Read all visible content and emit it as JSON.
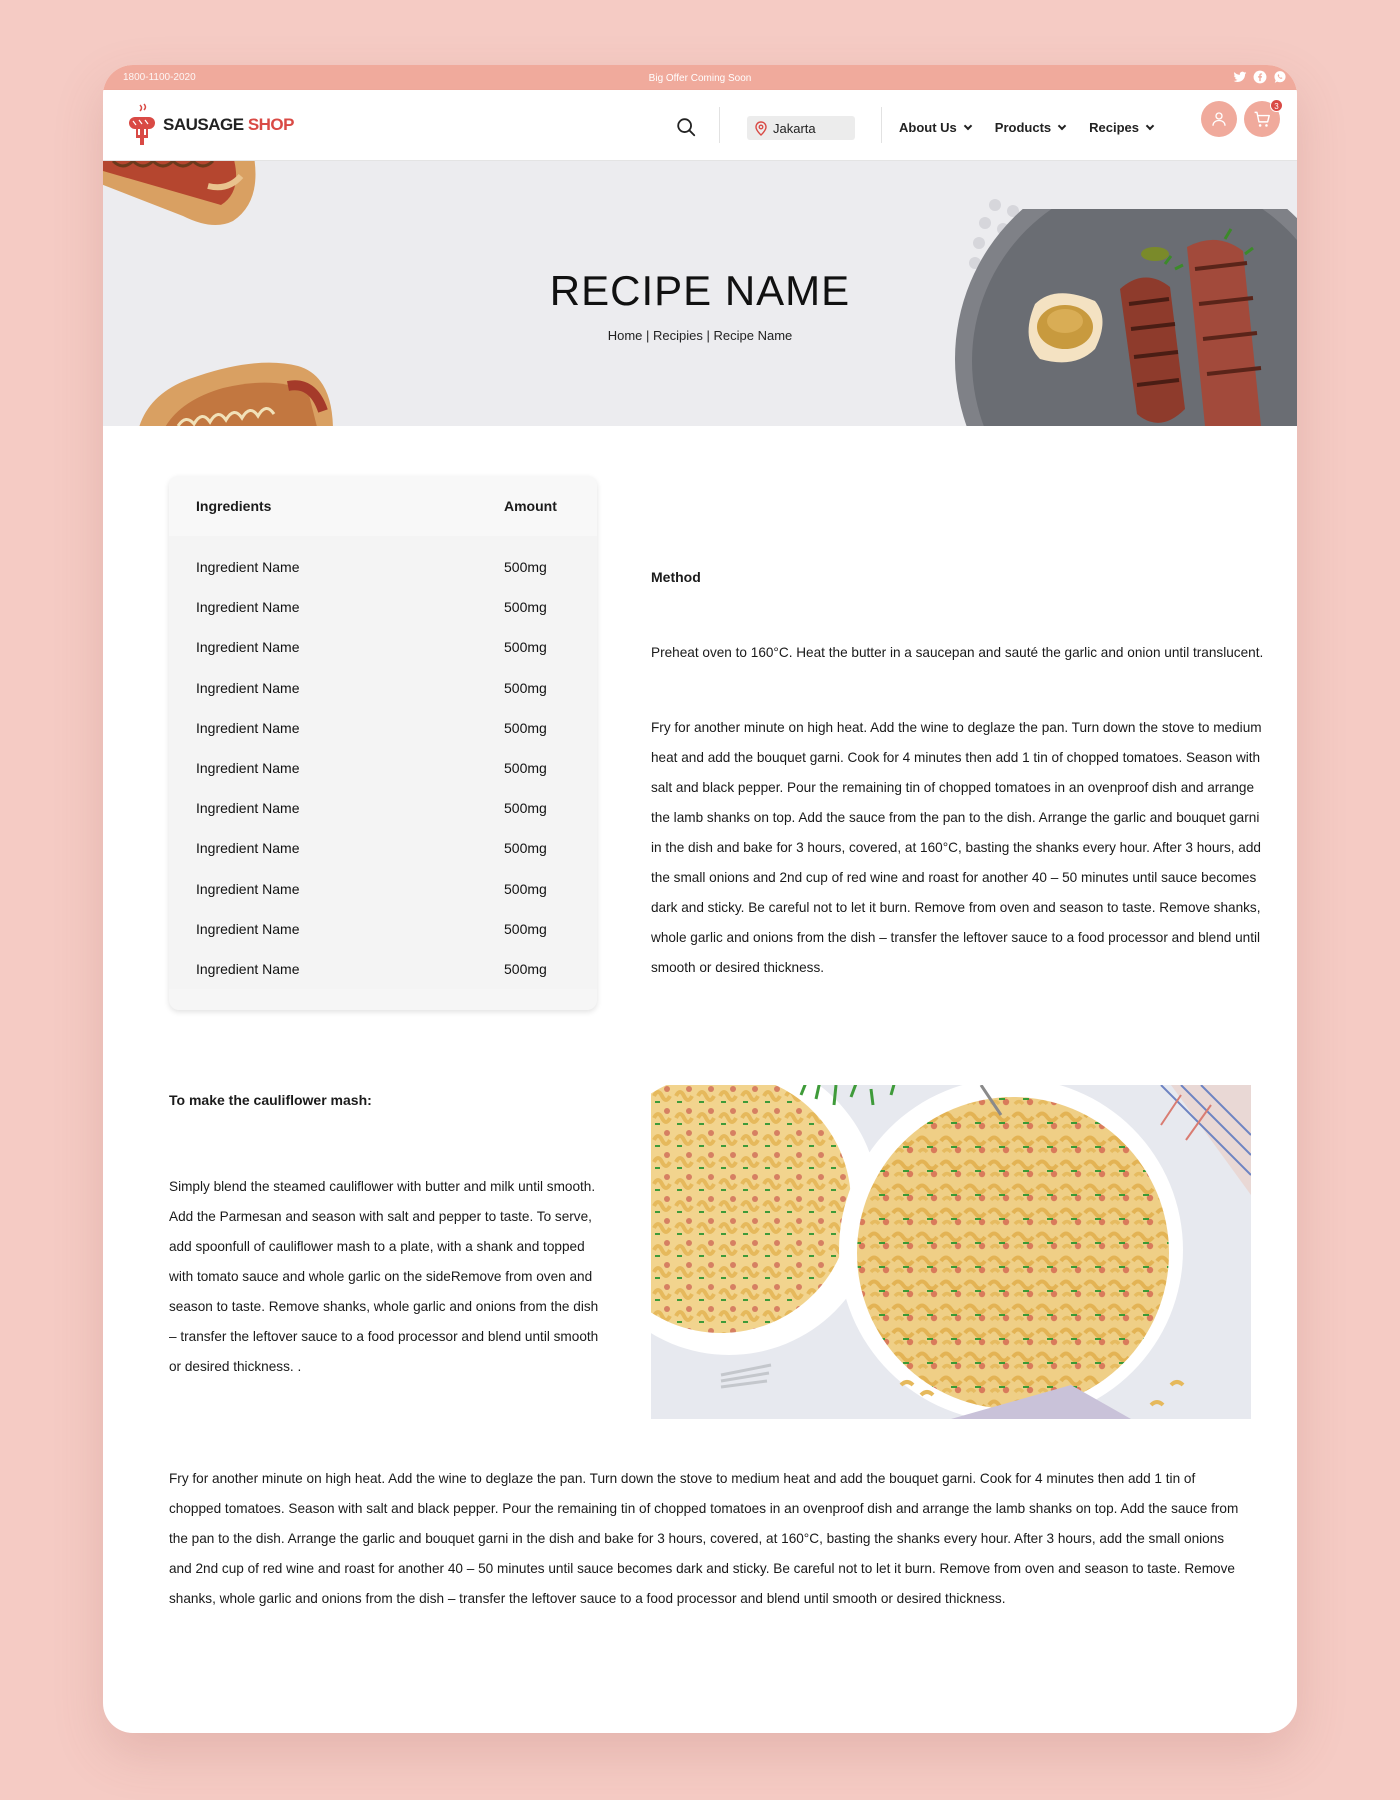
{
  "topbar": {
    "phone": "1800-1100-2020",
    "offer": "Big Offer Coming Soon",
    "socials": [
      "twitter-icon",
      "facebook-icon",
      "whatsapp-icon"
    ]
  },
  "header": {
    "logo": {
      "word1": "SAUSAGE",
      "word2": "SHOP"
    },
    "location": "Jakarta",
    "nav": [
      {
        "label": "About Us"
      },
      {
        "label": "Products"
      },
      {
        "label": "Recipes"
      }
    ],
    "cart_count": "3"
  },
  "hero": {
    "title": "RECIPE NAME",
    "breadcrumb": [
      "Home",
      "Recipies",
      "Recipe Name"
    ],
    "separator": "|"
  },
  "ingredients": {
    "header": {
      "name": "Ingredients",
      "amount": "Amount"
    },
    "rows": [
      {
        "name": "Ingredient Name",
        "amount": "500mg"
      },
      {
        "name": "Ingredient Name",
        "amount": "500mg"
      },
      {
        "name": "Ingredient Name",
        "amount": "500mg"
      },
      {
        "name": "Ingredient Name",
        "amount": "500mg"
      },
      {
        "name": "Ingredient Name",
        "amount": "500mg"
      },
      {
        "name": "Ingredient Name",
        "amount": "500mg"
      },
      {
        "name": "Ingredient Name",
        "amount": "500mg"
      },
      {
        "name": "Ingredient Name",
        "amount": "500mg"
      },
      {
        "name": "Ingredient Name",
        "amount": "500mg"
      },
      {
        "name": "Ingredient Name",
        "amount": "500mg"
      },
      {
        "name": "Ingredient Name",
        "amount": "500mg"
      }
    ]
  },
  "method": {
    "title": "Method",
    "para1": "Preheat oven to 160°C. Heat the butter in a saucepan and sauté the garlic and onion until translucent.",
    "para2": "Fry for another minute on high heat. Add the wine to deglaze the pan. Turn down the stove to medium heat and add the bouquet garni.  Cook for 4 minutes then add 1 tin of chopped tomatoes. Season with salt and black pepper. Pour the remaining tin of chopped tomatoes in an ovenproof dish and arrange the lamb shanks on top.  Add the sauce from the pan to the dish. Arrange the garlic and bouquet garni in the dish and bake for 3 hours, covered, at 160°C, basting the shanks every hour. After 3 hours, add the small onions and 2nd cup of red wine and roast for another 40 – 50 minutes until sauce becomes dark and sticky. Be careful not to let it burn. Remove from oven and season to taste. Remove shanks, whole garlic and onions from the dish – transfer the leftover sauce to a food processor and blend until smooth or desired thickness."
  },
  "cauliflower": {
    "title": "To make the cauliflower mash:",
    "text": "Simply blend the steamed cauliflower with butter and milk until smooth. Add the Parmesan and season with salt and pepper to taste. To serve, add spoonfull of cauliflower mash to a plate, with a shank and topped with tomato sauce and whole garlic on the sideRemove from oven and season to taste. Remove shanks, whole garlic and onions from the dish – transfer the leftover sauce to a food processor and blend until smooth or desired thickness. ."
  },
  "bottom": {
    "text": "Fry for another minute on high heat. Add the wine to deglaze the pan. Turn down the stove to medium heat and add the bouquet garni.  Cook for 4 minutes then add 1 tin of chopped tomatoes. Season with salt and black pepper. Pour the remaining tin of chopped tomatoes in an ovenproof dish and arrange the lamb shanks on top.  Add the sauce from the pan to the dish. Arrange the garlic and bouquet garni in the dish and bake for 3 hours, covered, at 160°C, basting the shanks every hour. After 3 hours, add the small onions and 2nd cup of red wine and roast for another 40 – 50 minutes until sauce becomes dark and sticky. Be careful not to let it burn. Remove from oven and season to taste. Remove shanks, whole garlic and onions from the dish – transfer the leftover sauce to a food processor and blend until smooth or desired thickness."
  },
  "colors": {
    "page_bg": "#f5cbc4",
    "accent": "#f0aa9c",
    "brand_red": "#d94a45",
    "hero_bg": "#ececef"
  }
}
